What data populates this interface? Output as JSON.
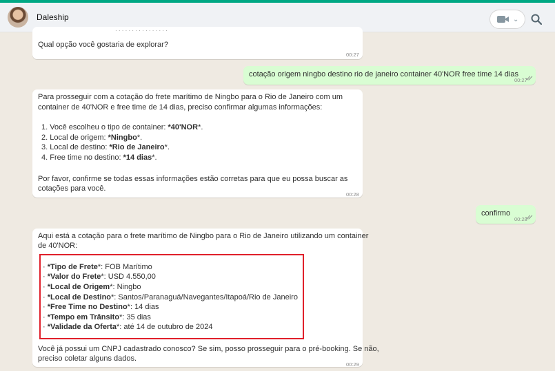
{
  "header": {
    "contact_name": "Daleship"
  },
  "messages": {
    "m1": {
      "cut_text": "· · · · · · · · · · · · · · · ·",
      "line": "Qual opção você gostaria de explorar?",
      "time": "00:27"
    },
    "m2": {
      "text": "cotação origem ningbo destino rio de janeiro container 40'NOR free time 14 dias",
      "time": "00:27"
    },
    "m3": {
      "p1": "Para prosseguir com a cotação do frete marítimo de Ningbo para o Rio de Janeiro com um",
      "p2": "container de 40'NOR e free time de 14 dias, preciso confirmar algumas informações:",
      "items": [
        {
          "num": "1.",
          "pre": "Você escolheu o tipo de container: ",
          "bold": "*40'NOR",
          "post": "*."
        },
        {
          "num": "2.",
          "pre": "Local de origem: ",
          "bold": "*Ningbo",
          "post": "*."
        },
        {
          "num": "3.",
          "pre": "Local de destino: ",
          "bold": "*Rio de Janeiro",
          "post": "*."
        },
        {
          "num": "4.",
          "pre": "Free time no destino: ",
          "bold": "*14 dias",
          "post": "*."
        }
      ],
      "c1": "Por favor, confirme se todas essas informações estão corretas para que eu possa buscar as",
      "c2": "cotações para você.",
      "time": "00:28"
    },
    "m4": {
      "text": "confirmo",
      "time": "00:28"
    },
    "m5": {
      "p1": "Aqui está a cotação para o frete marítimo de Ningbo para o Rio de Janeiro utilizando um container",
      "p2": "de 40'NOR:",
      "items": [
        {
          "bold": "*Tipo de Frete",
          "post": "*: FOB Marítimo"
        },
        {
          "bold": "*Valor do Frete",
          "post": "*: USD 4.550,00"
        },
        {
          "bold": "*Local de Origem",
          "post": "*: Ningbo"
        },
        {
          "bold": "*Local de Destino",
          "post": "*: Santos/Paranaguá/Navegantes/Itapoá/Rio de Janeiro"
        },
        {
          "bold": "*Free Time no Destino",
          "post": "*: 14 dias"
        },
        {
          "bold": "*Tempo em Trânsito",
          "post": "*: 35 dias"
        },
        {
          "bold": "*Validade da Oferta",
          "post": "*: até 14 de outubro de 2024"
        }
      ],
      "c1": "Você já possui um CNPJ cadastrado conosco? Se sim, posso prosseguir para o pré-booking. Se não,",
      "c2": "preciso coletar alguns dados.",
      "time": "00:29"
    }
  }
}
